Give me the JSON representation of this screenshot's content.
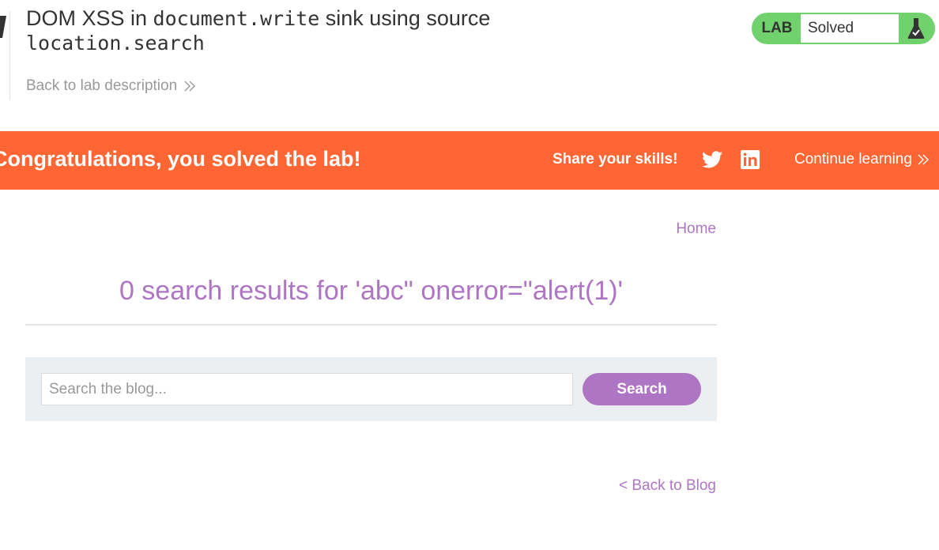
{
  "header": {
    "title_prefix": "DOM XSS in ",
    "title_code1": "document.write",
    "title_middle": " sink using source",
    "title_code2": "location.search",
    "back_link": "Back to lab description"
  },
  "status": {
    "lab_label": "LAB",
    "state": "Solved",
    "accent": "#70d16d"
  },
  "banner": {
    "message": "Congratulations, you solved the lab!",
    "share_label": "Share your skills!",
    "continue_label": "Continue learning",
    "color": "#ff6633"
  },
  "nav": {
    "home": "Home"
  },
  "results": {
    "heading": "0 search results for 'abc\" onerror=\"alert(1)'",
    "accent": "#ae75c5"
  },
  "search": {
    "placeholder": "Search the blog...",
    "value": "",
    "button": "Search"
  },
  "footer": {
    "back_to_blog": "< Back to Blog"
  },
  "icons": [
    "double-chevron-right-icon",
    "flask-check-icon",
    "twitter-icon",
    "linkedin-icon"
  ]
}
